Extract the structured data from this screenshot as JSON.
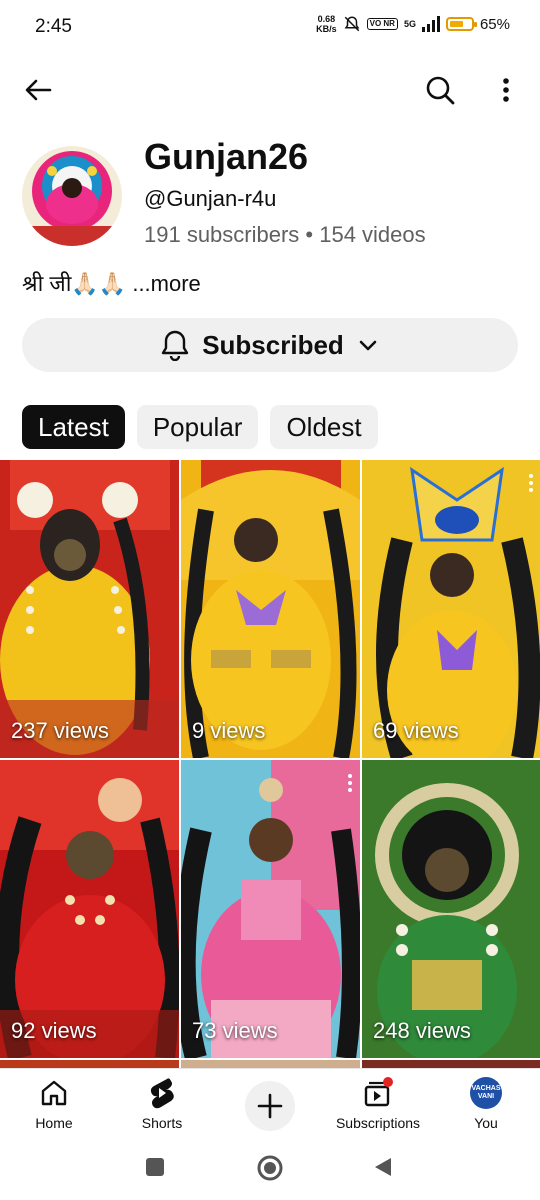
{
  "status_bar": {
    "time": "2:45",
    "net_speed_value": "0.68",
    "net_speed_unit": "KB/s",
    "volte": "VO NR",
    "network": "5G",
    "battery_percent": "65%",
    "battery_level": 0.65
  },
  "channel": {
    "name": "Gunjan26",
    "handle": "@Gunjan-r4u",
    "stats": "191 subscribers • 154 videos",
    "description": "श्री जी🙏🏻🙏🏻",
    "more_label": "...more"
  },
  "subscribe": {
    "label": "Subscribed"
  },
  "chips": [
    {
      "label": "Latest",
      "active": true
    },
    {
      "label": "Popular",
      "active": false
    },
    {
      "label": "Oldest",
      "active": false
    }
  ],
  "videos": [
    {
      "views": "237 views",
      "bg": "#c8241c",
      "accent": "#f2c21a"
    },
    {
      "views": "9 views",
      "bg": "#f0b414",
      "accent": "#d4331e"
    },
    {
      "views": "69 views",
      "bg": "#f0c424",
      "accent": "#2a2a2a"
    },
    {
      "views": "92 views",
      "bg": "#c41818",
      "accent": "#f3e2b0"
    },
    {
      "views": "73 views",
      "bg": "#e86a9a",
      "accent": "#6fc2d8"
    },
    {
      "views": "248 views",
      "bg": "#3a7a2a",
      "accent": "#c7b34a"
    }
  ],
  "bottom_nav": {
    "home": "Home",
    "shorts": "Shorts",
    "subscriptions": "Subscriptions",
    "you": "You",
    "you_avatar_text": "VACHAS VANI"
  },
  "colors": {
    "text": "#0f0f0f",
    "secondary_text": "#606060",
    "chip_bg": "#f0f0f0",
    "active_chip_bg": "#0f0f0f",
    "notification_dot": "#e52222"
  }
}
